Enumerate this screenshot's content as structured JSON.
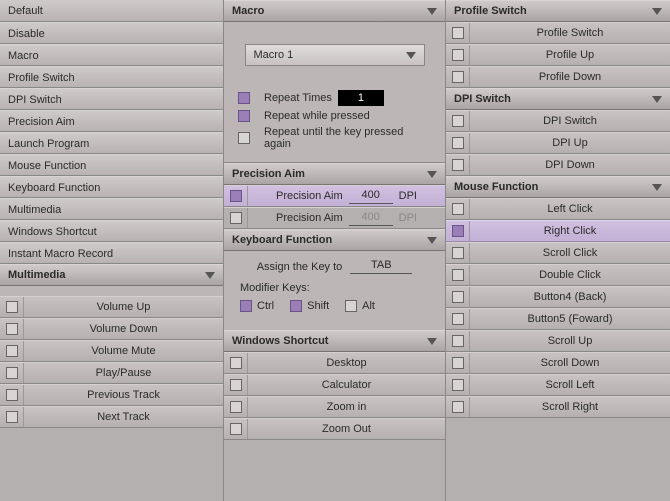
{
  "left": {
    "categories": [
      "Default",
      "Disable",
      "Macro",
      "Profile Switch",
      "DPI Switch",
      "Precision Aim",
      "Launch Program",
      "Mouse Function",
      "Keyboard Function",
      "Multimedia",
      "Windows Shortcut",
      "Instant Macro Record"
    ],
    "multimedia": {
      "title": "Multimedia",
      "items": [
        "Volume Up",
        "Volume Down",
        "Volume Mute",
        "Play/Pause",
        "Previous Track",
        "Next Track"
      ]
    }
  },
  "mid": {
    "macro": {
      "title": "Macro",
      "selected": "Macro 1",
      "repeat_times_label": "Repeat Times",
      "repeat_times_value": "1",
      "repeat_while_label": "Repeat while pressed",
      "repeat_until_label": "Repeat until the key pressed again"
    },
    "precision": {
      "title": "Precision Aim",
      "row_label": "Precision Aim",
      "dpi_suffix": "DPI",
      "value1": "400",
      "value2": "400"
    },
    "keyboard": {
      "title": "Keyboard Function",
      "assign_label": "Assign the Key to",
      "assign_value": "TAB",
      "mod_label": "Modifier Keys:",
      "ctrl": "Ctrl",
      "shift": "Shift",
      "alt": "Alt"
    },
    "winshort": {
      "title": "Windows Shortcut",
      "items": [
        "Desktop",
        "Calculator",
        "Zoom in",
        "Zoom Out"
      ]
    }
  },
  "right": {
    "profile": {
      "title": "Profile Switch",
      "items": [
        "Profile Switch",
        "Profile Up",
        "Profile Down"
      ]
    },
    "dpi": {
      "title": "DPI Switch",
      "items": [
        "DPI Switch",
        "DPI Up",
        "DPI Down"
      ]
    },
    "mouse": {
      "title": "Mouse Function",
      "items": [
        "Left Click",
        "Right Click",
        "Scroll Click",
        "Double Click",
        "Button4 (Back)",
        "Button5 (Foward)",
        "Scroll  Up",
        "Scroll Down",
        "Scroll Left",
        "Scroll Right"
      ],
      "selected_index": 1
    }
  }
}
